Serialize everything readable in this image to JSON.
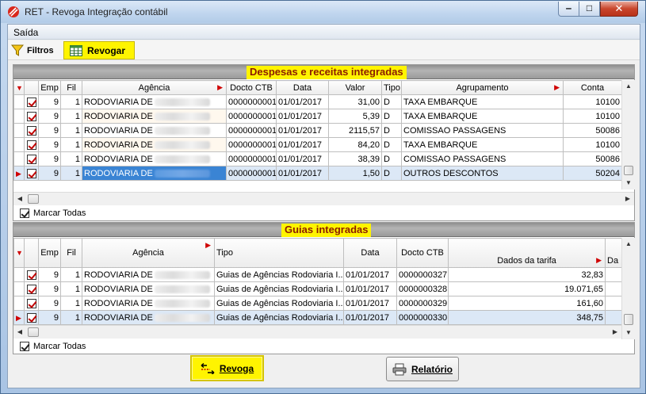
{
  "window": {
    "title": "RET - Revoga Integração contábil",
    "minimize_glyph": "‒",
    "maximize_glyph": "□",
    "close_glyph": "✕"
  },
  "menu": {
    "items": [
      "Saída"
    ]
  },
  "toolbar": {
    "filtros": "Filtros",
    "revogar": "Revogar"
  },
  "despesas": {
    "title": "Despesas e receitas integradas",
    "columns": [
      "Emp",
      "Fil",
      "Agência",
      "Docto CTB",
      "Data",
      "Valor",
      "Tipo",
      "Agrupamento",
      "Conta"
    ],
    "rows": [
      {
        "emp": "9",
        "fil": "1",
        "agencia": "RODOVIARIA DE",
        "docto": "0000000001",
        "data": "01/01/2017",
        "valor": "31,00",
        "tipo": "D",
        "agrupamento": "TAXA EMBARQUE",
        "conta": "10100"
      },
      {
        "emp": "9",
        "fil": "1",
        "agencia": "RODOVIARIA DE",
        "docto": "0000000001",
        "data": "01/01/2017",
        "valor": "5,39",
        "tipo": "D",
        "agrupamento": "TAXA EMBARQUE",
        "conta": "10100"
      },
      {
        "emp": "9",
        "fil": "1",
        "agencia": "RODOVIARIA DE",
        "docto": "0000000001",
        "data": "01/01/2017",
        "valor": "2115,57",
        "tipo": "D",
        "agrupamento": "COMISSAO PASSAGENS",
        "conta": "50086"
      },
      {
        "emp": "9",
        "fil": "1",
        "agencia": "RODOVIARIA DE",
        "docto": "0000000001",
        "data": "01/01/2017",
        "valor": "84,20",
        "tipo": "D",
        "agrupamento": "TAXA EMBARQUE",
        "conta": "10100"
      },
      {
        "emp": "9",
        "fil": "1",
        "agencia": "RODOVIARIA DE",
        "docto": "0000000001",
        "data": "01/01/2017",
        "valor": "38,39",
        "tipo": "D",
        "agrupamento": "COMISSAO PASSAGENS",
        "conta": "50086"
      },
      {
        "emp": "9",
        "fil": "1",
        "agencia": "RODOVIARIA DE",
        "docto": "0000000001",
        "data": "01/01/2017",
        "valor": "1,50",
        "tipo": "D",
        "agrupamento": "OUTROS DESCONTOS",
        "conta": "50204"
      }
    ],
    "mark_all": "Marcar Todas"
  },
  "guias": {
    "title": "Guias integradas",
    "columns": [
      "Emp",
      "Fil",
      "Agência",
      "Tipo",
      "Data",
      "Docto CTB",
      "Dados da tarifa",
      "Da"
    ],
    "rows": [
      {
        "emp": "9",
        "fil": "1",
        "agencia": "RODOVIARIA DE",
        "tipo": "Guias de Agências Rodoviaria I...",
        "data": "01/01/2017",
        "docto": "0000000327",
        "tarifa": "32,83"
      },
      {
        "emp": "9",
        "fil": "1",
        "agencia": "RODOVIARIA DE",
        "tipo": "Guias de Agências Rodoviaria I...",
        "data": "01/01/2017",
        "docto": "0000000328",
        "tarifa": "19.071,65"
      },
      {
        "emp": "9",
        "fil": "1",
        "agencia": "RODOVIARIA DE",
        "tipo": "Guias de Agências Rodoviaria I...",
        "data": "01/01/2017",
        "docto": "0000000329",
        "tarifa": "161,60"
      },
      {
        "emp": "9",
        "fil": "1",
        "agencia": "RODOVIARIA DE",
        "tipo": "Guias de Agências Rodoviaria I...",
        "data": "01/01/2017",
        "docto": "0000000330",
        "tarifa": "348,75"
      }
    ],
    "mark_all": "Marcar Todas"
  },
  "footer": {
    "revoga": "Revoga",
    "relatorio": "Relatório"
  },
  "colors": {
    "highlight": "#fff400",
    "selection": "#3a84d4",
    "check_red": "#c00000"
  },
  "icons": [
    "app-logo-icon",
    "filter-funnel-icon",
    "grid-table-icon",
    "revoke-arrows-icon",
    "printer-icon",
    "sort-arrow-icon",
    "row-indicator-icon"
  ]
}
